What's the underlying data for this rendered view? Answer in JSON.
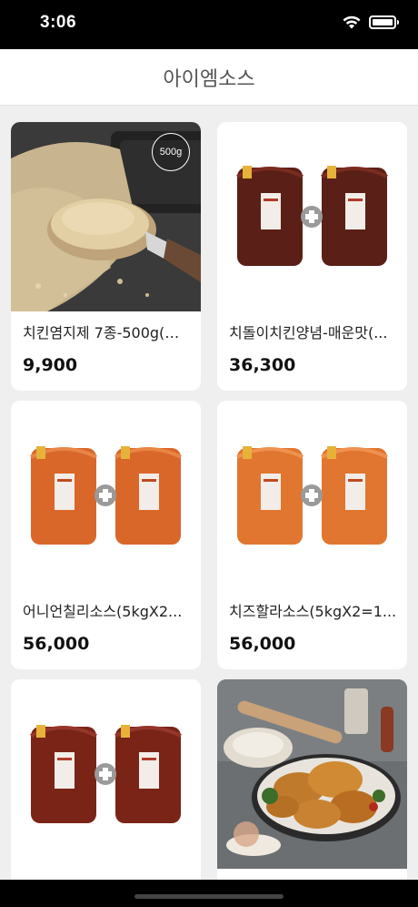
{
  "status_bar": {
    "time": "3:06",
    "icons": [
      "wifi-icon",
      "battery-icon"
    ]
  },
  "header": {
    "title": "아이엠소스"
  },
  "products": [
    {
      "name": "치킨염지제 7종-500g(…",
      "price": "9,900",
      "badge": "500g",
      "image": "seasoning-powder"
    },
    {
      "name": "치돌이치킨양념-매운맛(...",
      "price": "36,300",
      "image": "red-sauce-pouches"
    },
    {
      "name": "어니언칠리소스(5kgX2...",
      "price": "56,000",
      "image": "orange-sauce-pouches"
    },
    {
      "name": "치즈할라소스(5kgX2=1...",
      "price": "56,000",
      "image": "orange-sauce-pouches"
    },
    {
      "image": "red-sauce-pouches"
    },
    {
      "image": "fried-chicken-photo"
    }
  ],
  "colors": {
    "background": "#efefef",
    "card": "#ffffff",
    "status_bar": "#000000",
    "title_text": "#555555"
  }
}
